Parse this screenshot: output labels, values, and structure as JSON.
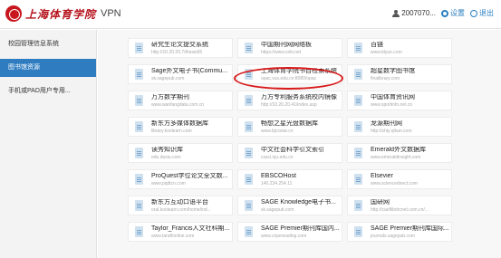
{
  "header": {
    "logo_text": "上海体育学院",
    "app_title": "VPN",
    "user_name": "2007070...",
    "settings_label": "设置",
    "logout_label": "退出"
  },
  "sidebar": {
    "items": [
      {
        "label": "校园管理信息系统",
        "active": false
      },
      {
        "label": "图书馆资源",
        "active": true
      },
      {
        "label": "手机或PAD用户专用...",
        "active": false
      }
    ]
  },
  "resources": [
    [
      {
        "title": "研究生论文提交系统",
        "url": "http://10.20.20.7/thesis65"
      },
      {
        "title": "中国期刊网网络板",
        "url": "https://www.cnki.net"
      },
      {
        "title": "百链",
        "url": "www.blyun.com"
      }
    ],
    [
      {
        "title": "Sage外文电子书(Commu...",
        "url": "sk.sagepub.com"
      },
      {
        "title": "上海体育学院书目检索系统",
        "url": "opac.sus.edu.cn:8080/opac"
      },
      {
        "title": "超星数字图书馆",
        "url": "finalibrary.com"
      }
    ],
    [
      {
        "title": "万方数字期刊",
        "url": "www.wanfangdata.com.cn"
      },
      {
        "title": "万方专利服务系统校内镜像",
        "url": "http://10.20.20.41/index.asp"
      },
      {
        "title": "中国体育资讯网",
        "url": "www.sportinfo.net.cn"
      }
    ],
    [
      {
        "title": "新东方多媒体数据库",
        "url": "library.koolearn.com"
      },
      {
        "title": "畅想之星光盘数据库",
        "url": "www.bjcxstar.cn"
      },
      {
        "title": "龙源期刊网",
        "url": "http://shty.qikan.com"
      }
    ],
    [
      {
        "title": "读秀知识库",
        "url": "edu.duxiu.com"
      },
      {
        "title": "中文社会科学引文索引",
        "url": "cssci.nju.edu.cn"
      },
      {
        "title": "Emerald外文数据库",
        "url": "www.emeraldinsight.com"
      }
    ],
    [
      {
        "title": "ProQuest学位论文全文数...",
        "url": "www.pqdtcn.com"
      },
      {
        "title": "EBSCOHost",
        "url": "140.234.254.11"
      },
      {
        "title": "Elsevier",
        "url": "www.sciencedirect.com"
      }
    ],
    [
      {
        "title": "新东方互动口语平台",
        "url": "oral.koolearn.com/home/ind..."
      },
      {
        "title": "SAGE Knowledge电子书...",
        "url": "sk.sagepub.com"
      },
      {
        "title": "国研网",
        "url": "http://caeflibdrcnet.com.cn/..."
      }
    ],
    [
      {
        "title": "Taylor_Francis人文社科期...",
        "url": "www.tandfonline.com"
      },
      {
        "title": "SAGE Premier期刊库国内...",
        "url": "www.cnpereading.com"
      },
      {
        "title": "SAGE Premier期刊库国际...",
        "url": "journals.sagepub.com"
      }
    ]
  ],
  "highlighted_resource": "上海体育学院书目检索系统",
  "colors": {
    "accent": "#2f7cc0",
    "logo_red": "#b5121b",
    "highlight_ring": "#d8191a"
  },
  "icons": [
    "school-emblem-icon",
    "user-icon",
    "gear-icon",
    "exit-icon",
    "document-icon"
  ]
}
